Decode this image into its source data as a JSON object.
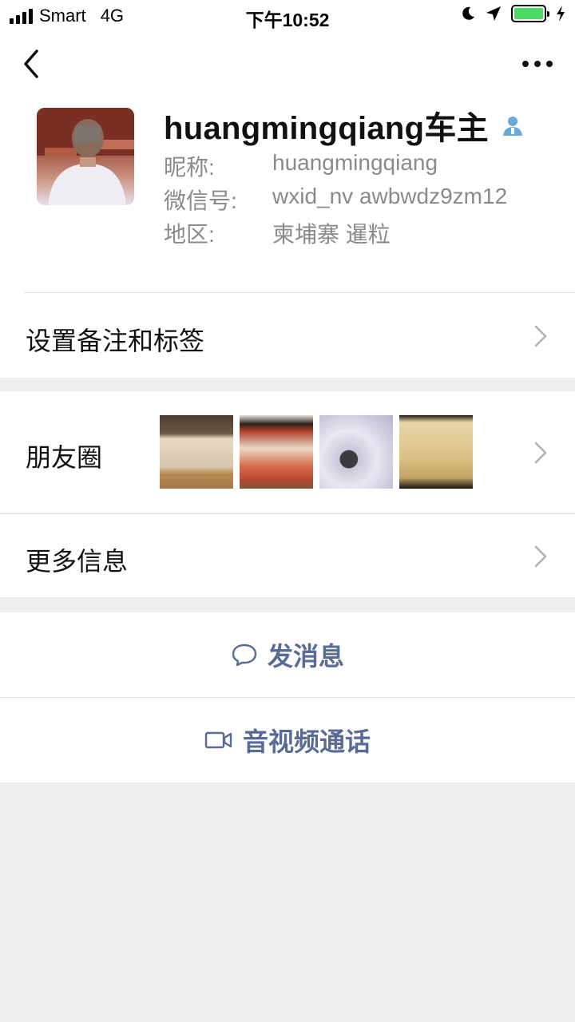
{
  "status_bar": {
    "carrier": "Smart",
    "network": "4G",
    "time": "下午10:52",
    "battery_color": "#4cd964"
  },
  "nav": {
    "back_icon": "chevron-left-icon",
    "more_icon": "ellipsis-icon"
  },
  "profile": {
    "display_name": "huangmingqiang车主",
    "contact_badge_icon": "contact-person-icon",
    "nickname_label": "昵称:",
    "nickname_value": "huangmingqiang",
    "wechat_id_label": "微信号:",
    "wechat_id_value": "wxid_nv awbwdz9zm12",
    "region_label": "地区:",
    "region_value": "柬埔寨 暹粒"
  },
  "rows": {
    "remark_label": "设置备注和标签",
    "moments_label": "朋友圈",
    "more_info_label": "更多信息"
  },
  "actions": {
    "message_label": "发消息",
    "message_icon": "chat-bubble-icon",
    "call_label": "音视频通话",
    "call_icon": "video-camera-icon",
    "link_color": "#576b95"
  }
}
